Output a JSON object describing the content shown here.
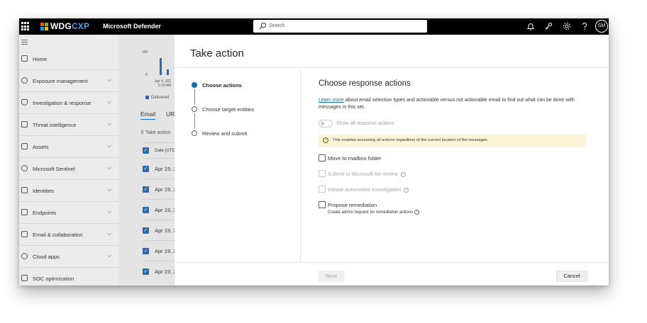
{
  "topbar": {
    "brand_part1": "WDG",
    "brand_part2": "CXP",
    "product": "Microsoft Defender",
    "search_placeholder": "Search",
    "avatar_initials": "SM",
    "icons": [
      "waffle-icon",
      "bell-icon",
      "connect-icon",
      "gear-icon",
      "help-icon"
    ],
    "brand_colors": [
      "#f25022",
      "#7fba00",
      "#00a4ef",
      "#ffb900"
    ]
  },
  "sidebar": {
    "items": [
      {
        "label": "Home",
        "icon": "home-icon",
        "chevron": false
      },
      {
        "label": "Exposure management",
        "icon": "exposure-icon",
        "chevron": true
      },
      {
        "label": "Investigation & response",
        "icon": "shield-icon",
        "chevron": true
      },
      {
        "label": "Threat intelligence",
        "icon": "book-icon",
        "chevron": true
      },
      {
        "label": "Assets",
        "icon": "assets-icon",
        "chevron": true
      },
      {
        "label": "Microsoft Sentinel",
        "icon": "sentinel-icon",
        "chevron": true
      },
      {
        "label": "Identities",
        "icon": "identity-icon",
        "chevron": true
      },
      {
        "label": "Endpoints",
        "icon": "endpoint-icon",
        "chevron": true
      },
      {
        "label": "Email & collaboration",
        "icon": "mail-icon",
        "chevron": true
      },
      {
        "label": "Cloud apps",
        "icon": "cloud-icon",
        "chevron": true
      },
      {
        "label": "SOC optimization",
        "icon": "soc-icon",
        "chevron": false
      }
    ]
  },
  "background": {
    "y_tick_top": "200",
    "y_tick_bottom": "0",
    "x_tick_date": "Apr 4, 202",
    "x_tick_time": "5:30 AM",
    "legend_label": "Delivered",
    "tab_email": "Email",
    "tab_url": "URI",
    "take_action": "Take action",
    "col_date": "Date (UTC",
    "rows": [
      "Apr 19, 2",
      "Apr 19, 2",
      "Apr 19, 2",
      "Apr 19, 2",
      "Apr 19, 2",
      "Apr 19, 2"
    ]
  },
  "panel": {
    "title": "Take action",
    "steps": [
      {
        "label": "Choose actions",
        "active": true
      },
      {
        "label": "Choose target entities",
        "active": false
      },
      {
        "label": "Review and submit",
        "active": false
      }
    ],
    "content_title": "Choose response actions",
    "learn_more": "Learn more",
    "description": " about email selection types and actionable versus not actionable email to find out what can be done with messages in this set.",
    "toggle_label": "Show all response actions",
    "banner_text": "This enables accessing all actions regardless of the current location of the messages.",
    "options": [
      {
        "label": "Move to mailbox folder",
        "disabled": false,
        "info": false
      },
      {
        "label": "Submit to Microsoft for review",
        "disabled": true,
        "info": true
      },
      {
        "label": "Initiate automated investigation",
        "disabled": true,
        "info": true
      },
      {
        "label": "Propose remediation",
        "disabled": false,
        "info": false,
        "sub": "Create admin request for remediation actions"
      }
    ],
    "next_label": "Next",
    "cancel_label": "Cancel"
  }
}
